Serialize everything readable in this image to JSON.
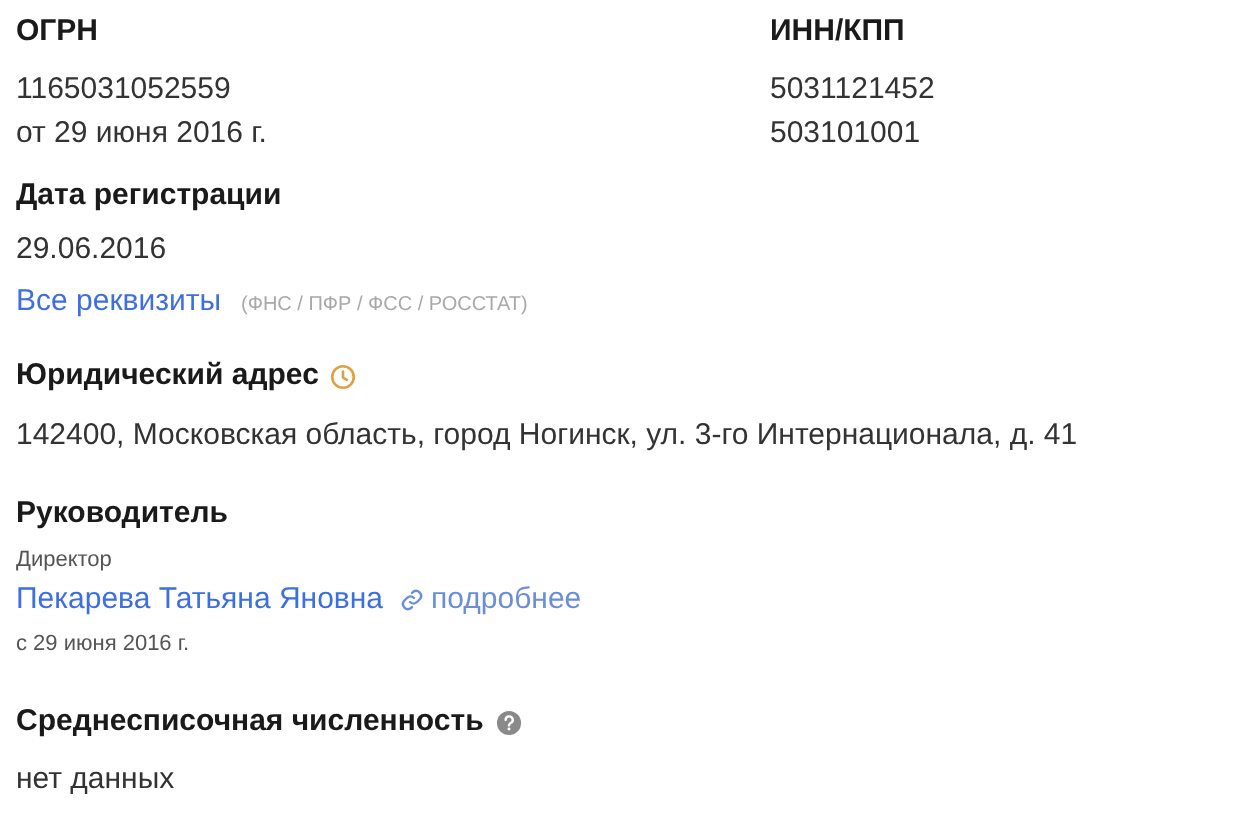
{
  "ogrn": {
    "label": "ОГРН",
    "value": "1165031052559",
    "date": "от 29 июня 2016 г."
  },
  "inn_kpp": {
    "label": "ИНН/КПП",
    "inn": "5031121452",
    "kpp": "503101001"
  },
  "registration": {
    "label": "Дата регистрации",
    "value": "29.06.2016"
  },
  "requisites": {
    "link": "Все реквизиты",
    "note": "(ФНС / ПФР / ФСС / РОССТАТ)"
  },
  "address": {
    "label": "Юридический адрес",
    "value": "142400, Московская область, город Ногинск, ул. 3-го Интернационала, д. 41"
  },
  "head": {
    "label": "Руководитель",
    "role": "Директор",
    "name": "Пекарева Татьяна Яновна",
    "more": "подробнее",
    "since": "с 29 июня 2016 г."
  },
  "staff": {
    "label": "Среднесписочная численность",
    "value": "нет данных"
  }
}
